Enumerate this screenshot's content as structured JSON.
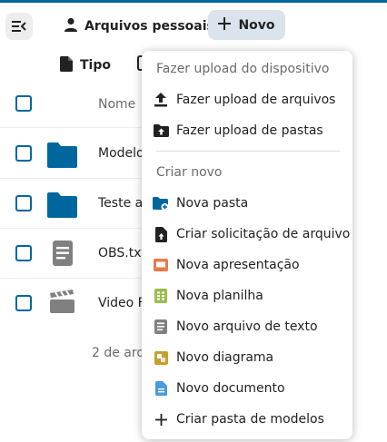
{
  "header": {
    "breadcrumb_label": "Arquivos pessoais",
    "new_button_label": "Novo"
  },
  "filters": {
    "type_label": "Tipo"
  },
  "table": {
    "column_name": "Nome",
    "rows": [
      {
        "name": "Modelo",
        "icon": "folder-icon"
      },
      {
        "name": "Teste ar",
        "icon": "folder-icon"
      },
      {
        "name": "OBS.txt",
        "icon": "text-file-icon"
      },
      {
        "name": "Video F",
        "icon": "video-icon"
      }
    ],
    "summary": "2 de arq"
  },
  "menu": {
    "section_upload": "Fazer upload do dispositivo",
    "upload_items": [
      {
        "label": "Fazer upload de arquivos",
        "icon": "upload-icon"
      },
      {
        "label": "Fazer upload de pastas",
        "icon": "folder-upload-icon"
      }
    ],
    "section_create": "Criar novo",
    "create_items": [
      {
        "label": "Nova pasta",
        "icon": "new-folder-icon"
      },
      {
        "label": "Criar solicitação de arquivo",
        "icon": "file-request-icon"
      },
      {
        "label": "Nova apresentação",
        "icon": "presentation-icon"
      },
      {
        "label": "Nova planilha",
        "icon": "spreadsheet-icon"
      },
      {
        "label": "Novo arquivo de texto",
        "icon": "text-file-icon"
      },
      {
        "label": "Novo diagrama",
        "icon": "diagram-icon"
      },
      {
        "label": "Novo documento",
        "icon": "document-icon"
      },
      {
        "label": "Criar pasta de modelos",
        "icon": "plus-icon"
      }
    ]
  },
  "colors": {
    "accent": "#00679e",
    "folder": "#00679e",
    "new_button_bg": "#dbe4ec",
    "presentation": "#e9794a",
    "spreadsheet": "#9abd4e",
    "diagram": "#c4a12f",
    "document": "#4a9bdb"
  }
}
